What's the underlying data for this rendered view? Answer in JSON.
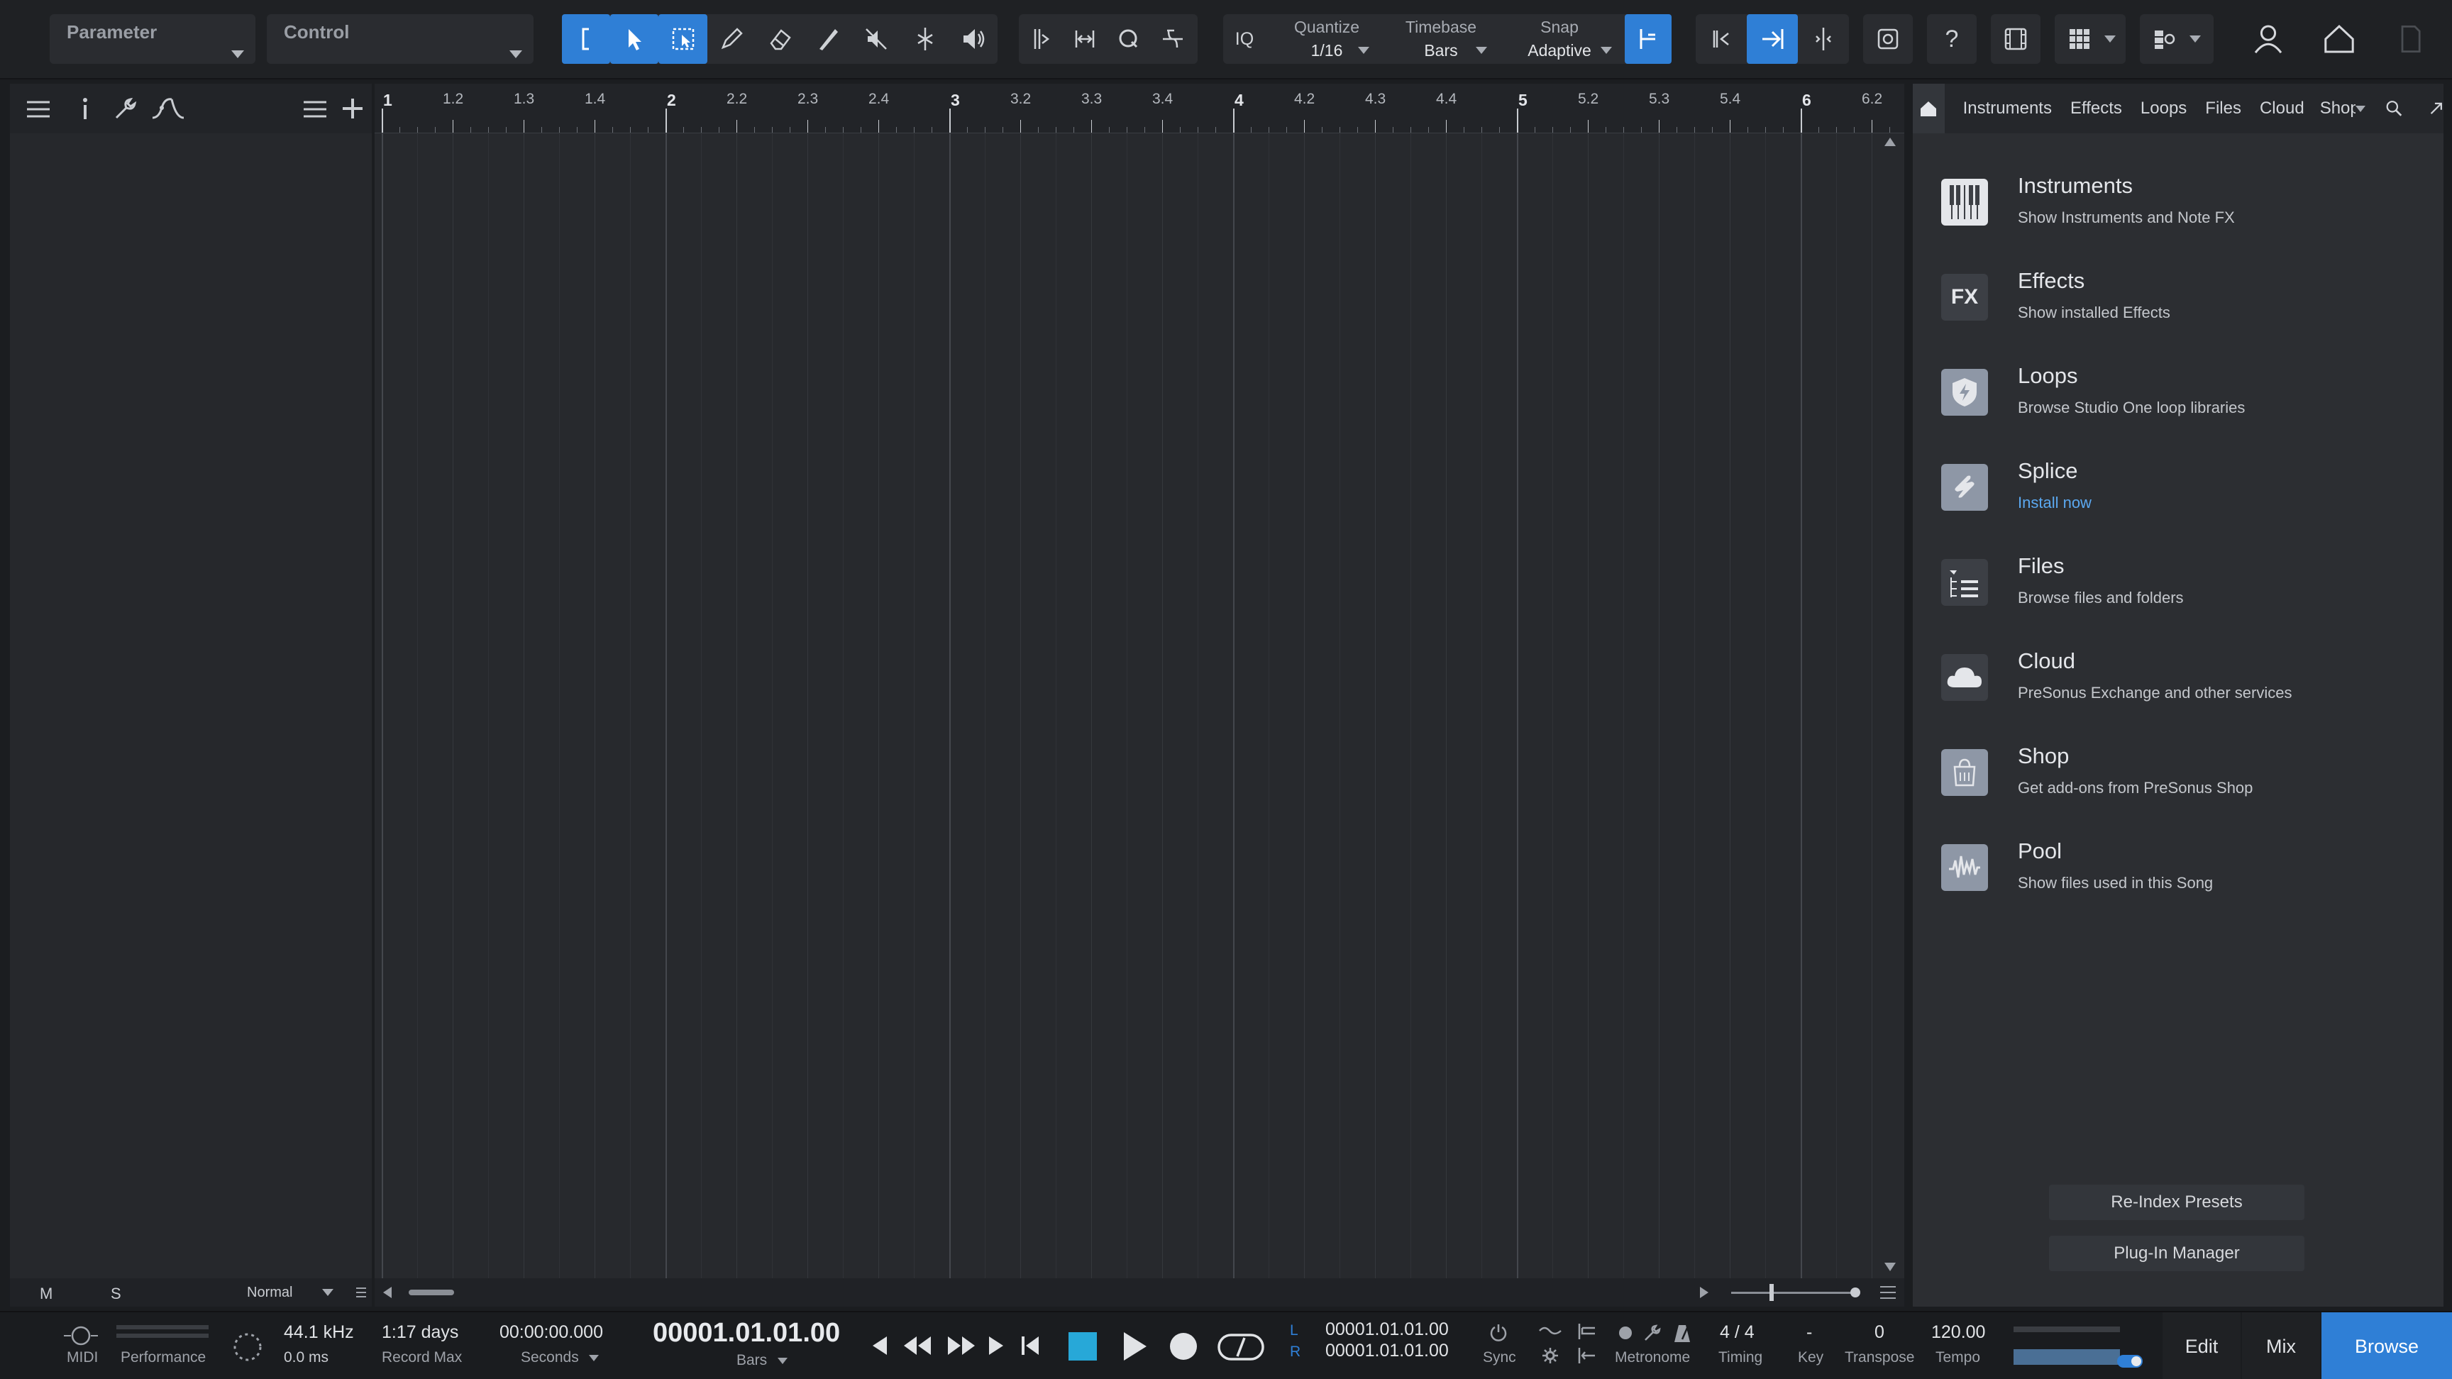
{
  "toolbar": {
    "parameter_label": "Parameter",
    "control_label": "Control",
    "iq_label": "IQ",
    "quantize_label": "Quantize",
    "quantize_value": "1/16",
    "timebase_label": "Timebase",
    "timebase_value": "Bars",
    "snap_label": "Snap",
    "snap_value": "Adaptive"
  },
  "ruler": {
    "marks": [
      {
        "label": "1",
        "major": true
      },
      {
        "label": "1.2",
        "major": false
      },
      {
        "label": "1.3",
        "major": false
      },
      {
        "label": "1.4",
        "major": false
      },
      {
        "label": "2",
        "major": true
      },
      {
        "label": "2.2",
        "major": false
      },
      {
        "label": "2.3",
        "major": false
      },
      {
        "label": "2.4",
        "major": false
      },
      {
        "label": "3",
        "major": true
      },
      {
        "label": "3.2",
        "major": false
      },
      {
        "label": "3.3",
        "major": false
      },
      {
        "label": "3.4",
        "major": false
      },
      {
        "label": "4",
        "major": true
      },
      {
        "label": "4.2",
        "major": false
      },
      {
        "label": "4.3",
        "major": false
      },
      {
        "label": "4.4",
        "major": false
      },
      {
        "label": "5",
        "major": true
      },
      {
        "label": "5.2",
        "major": false
      },
      {
        "label": "5.3",
        "major": false
      },
      {
        "label": "5.4",
        "major": false
      },
      {
        "label": "6",
        "major": true
      },
      {
        "label": "6.2",
        "major": false
      }
    ]
  },
  "left_footer": {
    "m": "M",
    "s": "S",
    "mode": "Normal"
  },
  "browser": {
    "tabs": [
      "Instruments",
      "Effects",
      "Loops",
      "Files",
      "Cloud",
      "Shop"
    ],
    "items": [
      {
        "title": "Instruments",
        "subtitle": "Show Instruments and Note FX",
        "icon": "keyboard-icon"
      },
      {
        "title": "Effects",
        "subtitle": "Show installed Effects",
        "icon": "fx-icon"
      },
      {
        "title": "Loops",
        "subtitle": "Browse Studio One loop libraries",
        "icon": "loops-icon"
      },
      {
        "title": "Splice",
        "subtitle": "Install now",
        "icon": "splice-icon"
      },
      {
        "title": "Files",
        "subtitle": "Browse files and folders",
        "icon": "files-icon"
      },
      {
        "title": "Cloud",
        "subtitle": "PreSonus Exchange and other services",
        "icon": "cloud-icon"
      },
      {
        "title": "Shop",
        "subtitle": "Get add-ons from PreSonus Shop",
        "icon": "shop-icon"
      },
      {
        "title": "Pool",
        "subtitle": "Show files used in this Song",
        "icon": "pool-icon"
      }
    ],
    "reindex_label": "Re-Index Presets",
    "plugin_manager_label": "Plug-In Manager",
    "fx_text": "FX"
  },
  "transport": {
    "midi_label": "MIDI",
    "performance_label": "Performance",
    "sample_rate": "44.1 kHz",
    "latency": "0.0 ms",
    "record_max_value": "1:17 days",
    "record_max_label": "Record Max",
    "seconds_value": "00:00:00.000",
    "seconds_label": "Seconds",
    "bars_value": "00001.01.01.00",
    "bars_label": "Bars",
    "left_locator_letter": "L",
    "right_locator_letter": "R",
    "left_locator": "00001.01.01.00",
    "right_locator": "00001.01.01.00",
    "sync_label": "Sync",
    "metronome_label": "Metronome",
    "timing_value": "4 / 4",
    "timing_label": "Timing",
    "key_value": "-",
    "key_label": "Key",
    "transpose_value": "0",
    "transpose_label": "Transpose",
    "tempo_value": "120.00",
    "tempo_label": "Tempo",
    "edit_label": "Edit",
    "mix_label": "Mix",
    "browse_label": "Browse"
  },
  "colors": {
    "accent": "#2f7fd6",
    "stop_cyan": "#27a8d8",
    "link": "#5ba8f0"
  }
}
